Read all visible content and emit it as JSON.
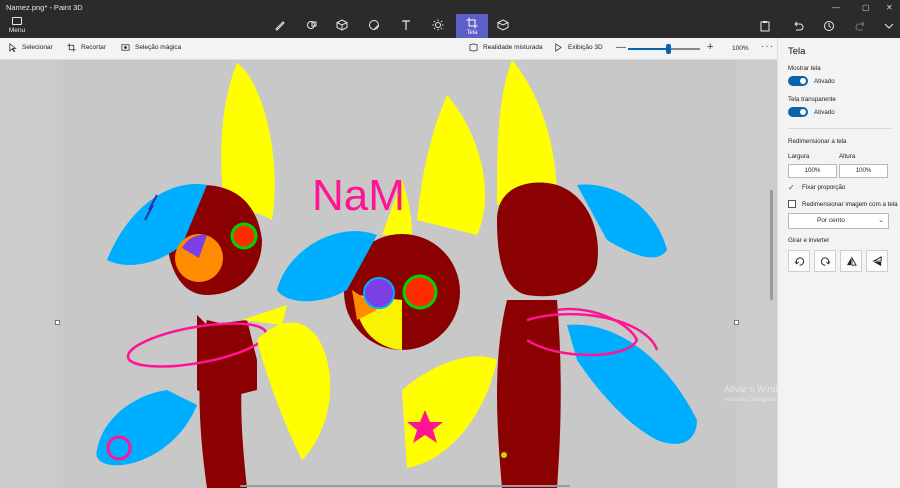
{
  "window": {
    "title": "Namez.png* - Paint 3D"
  },
  "toolbar": {
    "menu_label": "Menu",
    "active_tool_label": "Tela",
    "tools": [
      {
        "icon": "brush-icon"
      },
      {
        "icon": "shapes-2d-icon"
      },
      {
        "icon": "shapes-3d-icon"
      },
      {
        "icon": "stickers-icon"
      },
      {
        "icon": "text-icon"
      },
      {
        "icon": "effects-icon"
      },
      {
        "icon": "canvas-icon",
        "label": "Tela"
      },
      {
        "icon": "library-3d-icon"
      }
    ]
  },
  "commandbar": {
    "select": "Selecionar",
    "crop": "Recortar",
    "magic_select": "Seleção mágica",
    "mixed_reality": "Realidade misturada",
    "view_3d": "Exibição 3D",
    "zoom_value": "100%",
    "zoom_fraction": 0.56
  },
  "panel": {
    "title": "Tela",
    "show_canvas_label": "Mostrar tela",
    "show_canvas_state": "Ativado",
    "transparent_label": "Tela transparente",
    "transparent_state": "Ativado",
    "resize_label": "Redimensionar a tela",
    "width_label": "Largura",
    "height_label": "Altura",
    "width_value": "100%",
    "height_value": "100%",
    "lock_ratio_label": "Fixar proporção",
    "resize_image_label": "Redimensionar imagem com a tela",
    "unit_selected": "Por cento",
    "rotate_flip_label": "Girar e inverter"
  },
  "watermark": {
    "line1": "Ativar o Windows",
    "line2": "Acesse Configurações para ativar o Windows."
  },
  "artwork": {
    "title_fragment": "NaM"
  },
  "colors": {
    "accent": "#0a64ad",
    "active_tool": "#5b5fc7",
    "maroon": "#8b0000",
    "yellow": "#ffff00",
    "cyan": "#00aeff",
    "magenta": "#ff1493",
    "green": "#00d400"
  }
}
